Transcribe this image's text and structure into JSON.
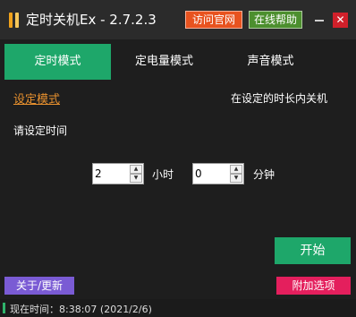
{
  "window": {
    "title": "定时关机Ex - 2.7.2.3",
    "logo_icon": "app-bars-icon",
    "buttons": {
      "website": "访问官网",
      "help": "在线帮助",
      "close": "✕"
    }
  },
  "tabs": [
    {
      "label": "定时模式",
      "active": true
    },
    {
      "label": "定电量模式",
      "active": false
    },
    {
      "label": "声音模式",
      "active": false
    }
  ],
  "content": {
    "mode_link": "设定模式",
    "mode_description": "在设定的时长内关机",
    "time_prompt": "请设定时间",
    "hours": {
      "value": "2",
      "unit": "小时"
    },
    "minutes": {
      "value": "0",
      "unit": "分钟"
    },
    "start_label": "开始"
  },
  "footer": {
    "about_label": "关于/更新",
    "extra_label": "附加选项"
  },
  "status": {
    "text": "现在时间：8:38:07 (2021/2/6)"
  },
  "colors": {
    "accent_green": "#1ea76a",
    "website_button": "#e8531f",
    "help_button": "#4c8f2e",
    "close_button": "#d0202a",
    "mode_link": "#e7902e",
    "about_button": "#7a5bd4",
    "extra_button": "#e41f5d"
  }
}
